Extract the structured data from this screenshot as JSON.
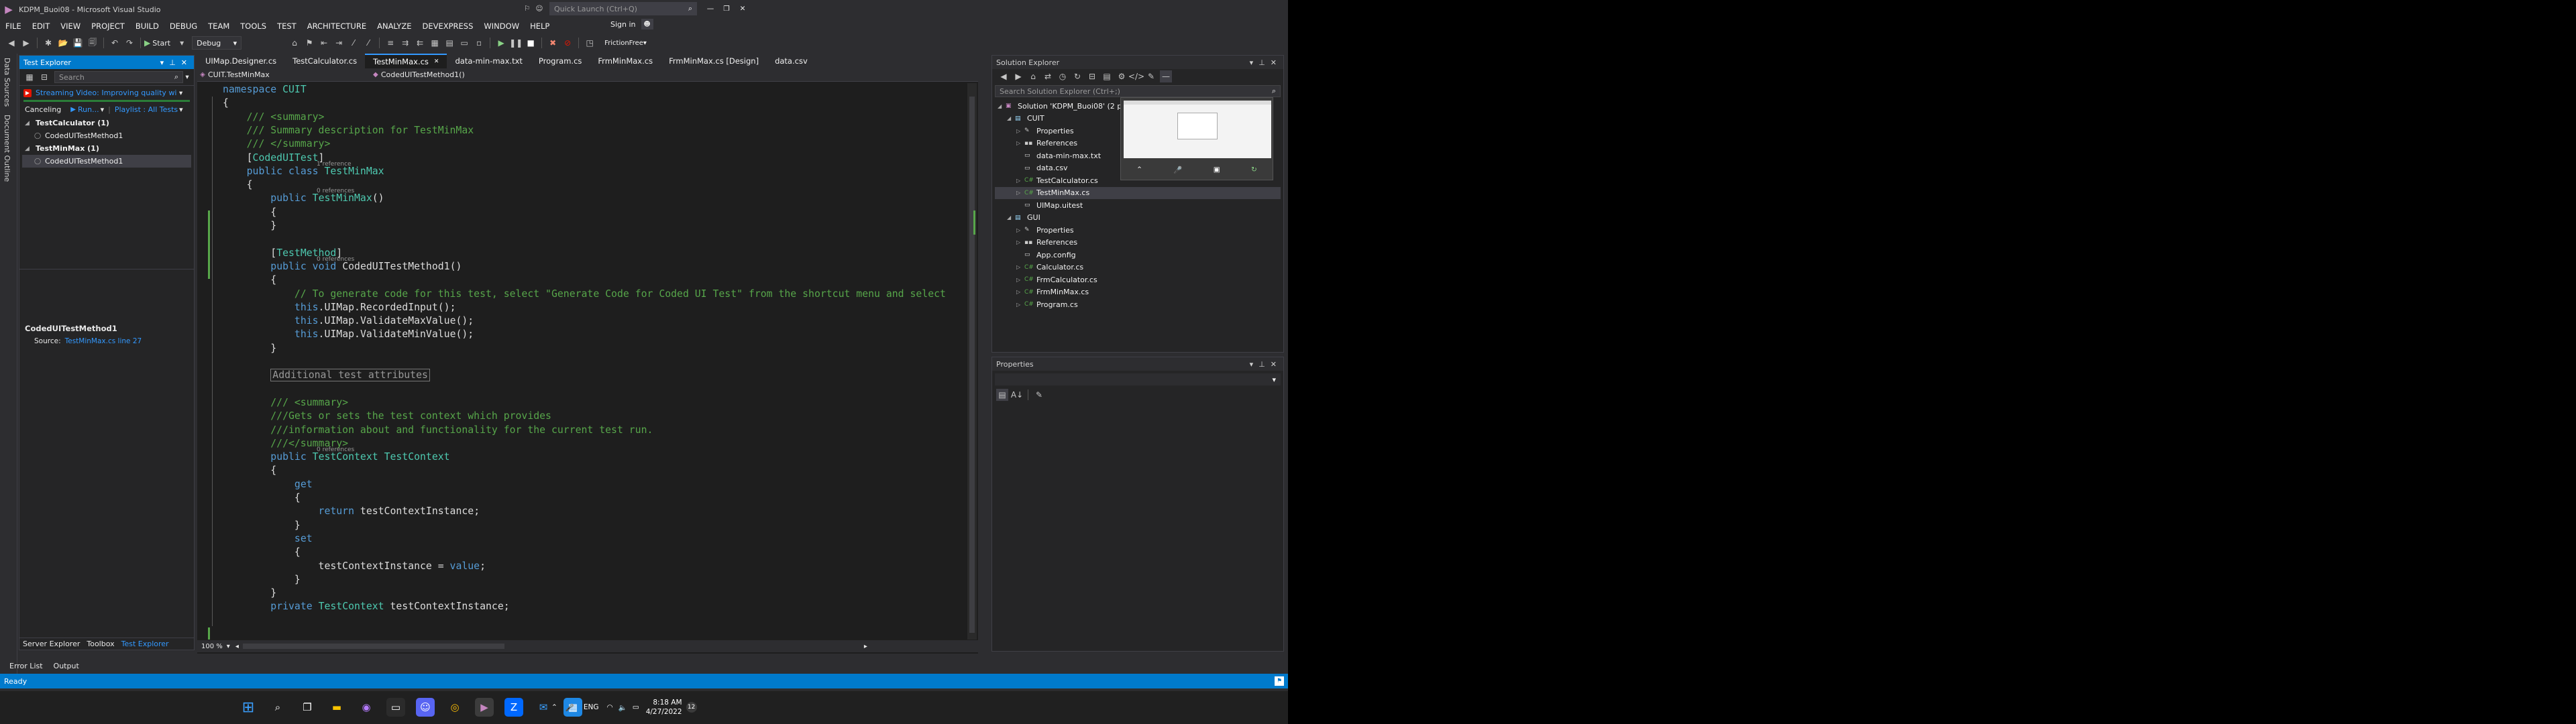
{
  "window": {
    "title": "KDPM_Buoi08 - Microsoft Visual Studio",
    "quick_launch_placeholder": "Quick Launch (Ctrl+Q)",
    "sign_in": "Sign in"
  },
  "menu": [
    "FILE",
    "EDIT",
    "VIEW",
    "PROJECT",
    "BUILD",
    "DEBUG",
    "TEAM",
    "TOOLS",
    "TEST",
    "ARCHITECTURE",
    "ANALYZE",
    "DEVEXPRESS",
    "WINDOW",
    "HELP"
  ],
  "toolbar": {
    "start_label": "Start",
    "config_value": "Debug",
    "theme_value": "FrictionFree"
  },
  "vertical_tabs": [
    "Data Sources",
    "Document Outline"
  ],
  "test_explorer": {
    "title": "Test Explorer",
    "search_placeholder": "Search",
    "banner": "Streaming Video: Improving quality with...",
    "canceling": "Canceling",
    "run_label": "Run...",
    "playlist_label": "Playlist : All Tests",
    "tree": [
      {
        "label": "TestCalculator (1)",
        "level": 0
      },
      {
        "label": "CodedUITestMethod1",
        "level": 1
      },
      {
        "label": "TestMinMax (1)",
        "level": 0
      },
      {
        "label": "CodedUITestMethod1",
        "level": 1
      }
    ],
    "detail_title": "CodedUITestMethod1",
    "detail_source_label": "Source:",
    "detail_source_link": "TestMinMax.cs line 27",
    "bottom_tabs": [
      "Server Explorer",
      "Toolbox",
      "Test Explorer"
    ]
  },
  "editor": {
    "tabs": [
      "UIMap.Designer.cs",
      "TestCalculator.cs",
      "TestMinMax.cs",
      "data-min-max.txt",
      "Program.cs",
      "FrmMinMax.cs",
      "FrmMinMax.cs [Design]",
      "data.csv"
    ],
    "active_tab": "TestMinMax.cs",
    "nav_left": "CUIT.TestMinMax",
    "nav_right": "CodedUITestMethod1()",
    "zoom": "100 %",
    "code": [
      {
        "t": "namespace CUIT",
        "c": "kw-ns"
      },
      {
        "t": "{",
        "c": "pl"
      },
      {
        "t": "    /// <summary>",
        "c": "cm"
      },
      {
        "t": "    /// Summary description for TestMinMax",
        "c": "cm"
      },
      {
        "t": "    /// </summary>",
        "c": "cm"
      },
      {
        "t": "    [CodedUITest]",
        "c": "attr"
      },
      {
        "t": "    public class TestMinMax",
        "c": "classdecl"
      },
      {
        "t": "    {",
        "c": "pl"
      },
      {
        "t": "        public TestMinMax()",
        "c": "ctor"
      },
      {
        "t": "        {",
        "c": "pl"
      },
      {
        "t": "        }",
        "c": "pl"
      },
      {
        "t": "",
        "c": "pl"
      },
      {
        "t": "        [TestMethod]",
        "c": "attr"
      },
      {
        "t": "        public void CodedUITestMethod1()",
        "c": "method"
      },
      {
        "t": "        {",
        "c": "pl"
      },
      {
        "t": "            // To generate code for this test, select \"Generate Code for Coded UI Test\" from the shortcut menu and select",
        "c": "cm"
      },
      {
        "t": "            this.UIMap.RecordedInput();",
        "c": "call"
      },
      {
        "t": "            this.UIMap.ValidateMaxValue();",
        "c": "call"
      },
      {
        "t": "            this.UIMap.ValidateMinValue();",
        "c": "call"
      },
      {
        "t": "        }",
        "c": "pl"
      },
      {
        "t": "",
        "c": "pl"
      },
      {
        "t": "        Additional test attributes",
        "c": "region"
      },
      {
        "t": "",
        "c": "pl"
      },
      {
        "t": "        /// <summary>",
        "c": "cm"
      },
      {
        "t": "        ///Gets or sets the test context which provides",
        "c": "cm"
      },
      {
        "t": "        ///information about and functionality for the current test run.",
        "c": "cm"
      },
      {
        "t": "        ///</summary>",
        "c": "cm"
      },
      {
        "t": "        public TestContext TestContext",
        "c": "prop"
      },
      {
        "t": "        {",
        "c": "pl"
      },
      {
        "t": "            get",
        "c": "kwline"
      },
      {
        "t": "            {",
        "c": "pl"
      },
      {
        "t": "                return testContextInstance;",
        "c": "ret"
      },
      {
        "t": "            }",
        "c": "pl"
      },
      {
        "t": "            set",
        "c": "kwline"
      },
      {
        "t": "            {",
        "c": "pl"
      },
      {
        "t": "                testContextInstance = value;",
        "c": "assign"
      },
      {
        "t": "            }",
        "c": "pl"
      },
      {
        "t": "        }",
        "c": "pl"
      },
      {
        "t": "        private TestContext testContextInstance;",
        "c": "field"
      }
    ],
    "lenses": {
      "class_refs": "1 reference",
      "ctor_refs": "0 references",
      "method_refs": "0 references",
      "prop_refs": "0 references"
    }
  },
  "solution_explorer": {
    "title": "Solution Explorer",
    "search_placeholder": "Search Solution Explorer (Ctrl+;)",
    "items": [
      {
        "label": "Solution 'KDPM_Buoi08' (2 pro",
        "level": 0,
        "icon": "solution"
      },
      {
        "label": "CUIT",
        "level": 1,
        "icon": "project"
      },
      {
        "label": "Properties",
        "level": 2,
        "icon": "wrench"
      },
      {
        "label": "References",
        "level": 2,
        "icon": "refs"
      },
      {
        "label": "data-min-max.txt",
        "level": 2,
        "icon": "file"
      },
      {
        "label": "data.csv",
        "level": 2,
        "icon": "file"
      },
      {
        "label": "TestCalculator.cs",
        "level": 2,
        "icon": "cs"
      },
      {
        "label": "TestMinMax.cs",
        "level": 2,
        "icon": "cs",
        "selected": true
      },
      {
        "label": "UIMap.uitest",
        "level": 2,
        "icon": "file"
      },
      {
        "label": "GUI",
        "level": 1,
        "icon": "project"
      },
      {
        "label": "Properties",
        "level": 2,
        "icon": "wrench"
      },
      {
        "label": "References",
        "level": 2,
        "icon": "refs"
      },
      {
        "label": "App.config",
        "level": 2,
        "icon": "file"
      },
      {
        "label": "Calculator.cs",
        "level": 2,
        "icon": "cs"
      },
      {
        "label": "FrmCalculator.cs",
        "level": 2,
        "icon": "cs"
      },
      {
        "label": "FrmMinMax.cs",
        "level": 2,
        "icon": "cs"
      },
      {
        "label": "Program.cs",
        "level": 2,
        "icon": "cs"
      }
    ]
  },
  "properties": {
    "title": "Properties"
  },
  "status": {
    "text": "Ready",
    "bottom_tabs": [
      "Error List",
      "Output"
    ]
  },
  "taskbar": {
    "lang": "ENG",
    "time": "8:18 AM",
    "date": "4/27/2022",
    "notif_count": "12"
  },
  "colors": {
    "accent": "#007acc",
    "bg": "#2d2d30",
    "editor_bg": "#1e1e1e"
  }
}
